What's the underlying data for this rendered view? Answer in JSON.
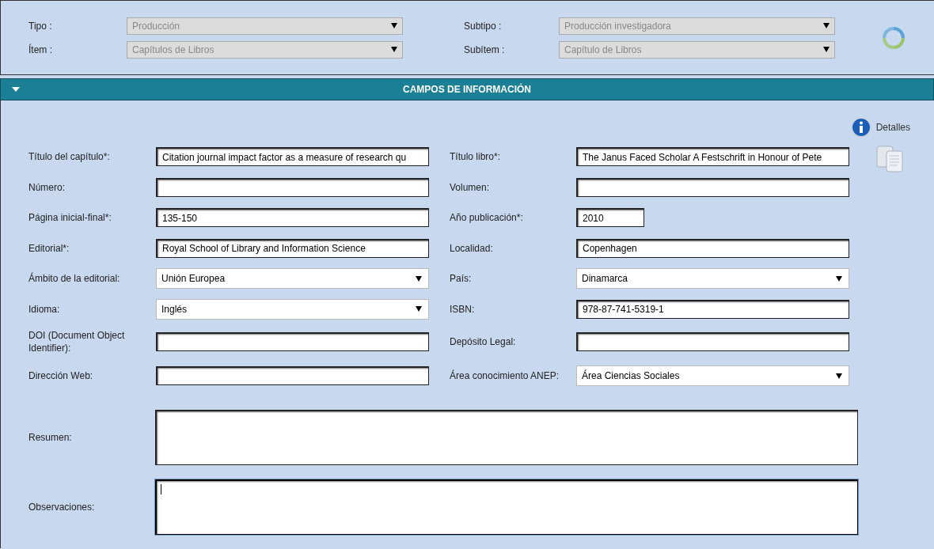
{
  "filters": [
    {
      "label": "Tipo :",
      "value": "Producción",
      "disabled": true
    },
    {
      "label": "Subtipo :",
      "value": "Producción investigadora",
      "disabled": true
    },
    {
      "label": "Ítem :",
      "value": "Capítulos de Libros",
      "disabled": true
    },
    {
      "label": "Subítem :",
      "value": "Capítulo de Libros",
      "disabled": true
    }
  ],
  "section": {
    "title": "CAMPOS DE INFORMACIÓN",
    "expanded": true
  },
  "details_link": "Detalles",
  "rows": [
    [
      {
        "label": "Título del capítulo*:",
        "kind": "text",
        "value": "Citation journal impact factor as a measure of research qu"
      },
      {
        "label": "Título libro*:",
        "kind": "text",
        "value": "The Janus Faced Scholar A Festschrift in Honour of Pete"
      }
    ],
    [
      {
        "label": "Número:",
        "kind": "text"
      },
      {
        "label": "Volumen:",
        "kind": "text"
      }
    ],
    [
      {
        "label": "Página inicial-final*:",
        "kind": "text",
        "value": "135-150"
      },
      {
        "label": "Año publicación*:",
        "kind": "short",
        "value": "2010"
      }
    ],
    [
      {
        "label": "Editorial*:",
        "kind": "text",
        "value": "Royal School of Library and Information Science"
      },
      {
        "label": "Localidad:",
        "kind": "text",
        "value": "Copenhagen"
      }
    ],
    [
      {
        "label": "Ámbito de la editorial:",
        "kind": "select",
        "value": "Unión Europea"
      },
      {
        "label": "País:",
        "kind": "select",
        "value": "Dinamarca"
      }
    ],
    [
      {
        "label": "Idioma:",
        "kind": "select",
        "value": "Inglés"
      },
      {
        "label": "ISBN:",
        "kind": "text",
        "value": "978-87-741-5319-1"
      }
    ],
    [
      {
        "label": "DOI (Document Object Identifier):",
        "kind": "text"
      },
      {
        "label": "Depósito Legal:",
        "kind": "text"
      }
    ],
    [
      {
        "label": "Dirección Web:",
        "kind": "text"
      },
      {
        "label": "Área conocimiento ANEP:",
        "kind": "select",
        "value": "Área Ciencias Sociales"
      }
    ]
  ],
  "text_areas": [
    {
      "label": "Resumen:",
      "focused": false
    },
    {
      "label": "Observaciones:",
      "focused": true
    }
  ]
}
